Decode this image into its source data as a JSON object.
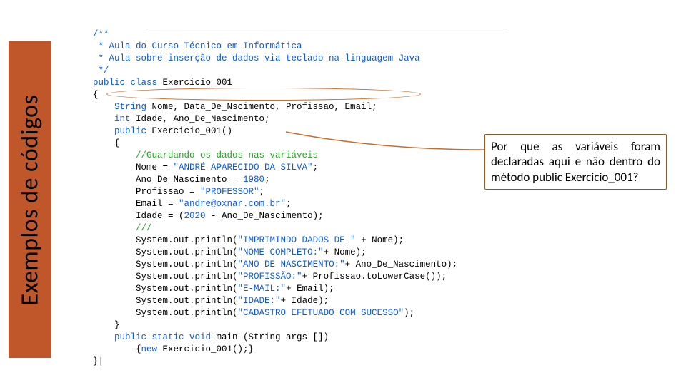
{
  "sidebar": {
    "title": "Exemplos de códigos"
  },
  "callout": {
    "text": "Por que as variáveis foram declaradas aqui e não dentro do método public Exercicio_001?"
  },
  "code": {
    "l1": "/**",
    "l2": " * Aula do Curso Técnico em Informática",
    "l3": " * Aula sobre inserção de dados via teclado na linguagem Java",
    "l4": " */",
    "l5a": "public class",
    "l5b": " Exercicio_001",
    "l6": "{",
    "l7a": "    String",
    "l7b": " Nome, Data_De_Nscimento, Profissao, Email;",
    "l8a": "    int",
    "l8b": " Idade, Ano_De_Nascimento;",
    "l9a": "    public",
    "l9b": " Exercicio_001()",
    "l10": "    {",
    "l11": "        //Guardando os dados nas variáveis",
    "l12a": "        Nome = ",
    "l12b": "\"ANDRÉ APARECIDO DA SILVA\"",
    "l12c": ";",
    "l13a": "        Ano_De_Nascimento = ",
    "l13b": "1980",
    "l13c": ";",
    "l14a": "        Profissao = ",
    "l14b": "\"PROFESSOR\"",
    "l14c": ";",
    "l15a": "        Email = ",
    "l15b": "\"andre@oxnar.com.br\"",
    "l15c": ";",
    "l16a": "        Idade = (",
    "l16b": "2020",
    "l16c": " - Ano_De_Nascimento);",
    "l17": "        ///",
    "l18a": "        System.out.println(",
    "l18b": "\"IMPRIMINDO DADOS DE \"",
    "l18c": " + Nome);",
    "l19a": "        System.out.println(",
    "l19b": "\"NOME COMPLETO:\"",
    "l19c": "+ Nome);",
    "l20a": "        System.out.println(",
    "l20b": "\"ANO DE NASCIMENTO:\"",
    "l20c": "+ Ano_De_Nascimento);",
    "l21a": "        System.out.println(",
    "l21b": "\"PROFISSÃO:\"",
    "l21c": "+ Profissao.toLowerCase());",
    "l22a": "        System.out.println(",
    "l22b": "\"E-MAIL:\"",
    "l22c": "+ Email);",
    "l23a": "        System.out.println(",
    "l23b": "\"IDADE:\"",
    "l23c": "+ Idade);",
    "l24a": "        System.out.println(",
    "l24b": "\"CADASTRO EFETUADO COM SUCESSO\"",
    "l24c": ");",
    "l25": "    }",
    "l26a": "    public static void",
    "l26b": " main (String args [])",
    "l27a": "        {",
    "l27b": "new",
    "l27c": " Exercicio_001();}",
    "l28": "}|"
  }
}
